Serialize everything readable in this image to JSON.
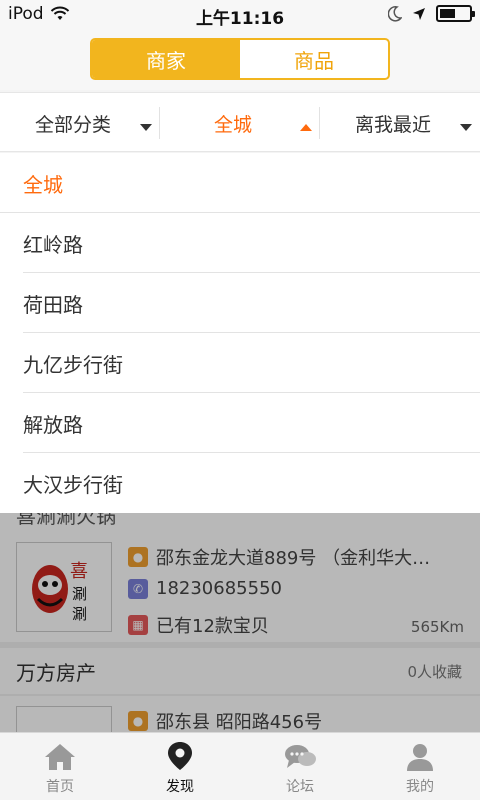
{
  "status_bar": {
    "device": "iPod",
    "time": "上午11:16",
    "battery_level": 0.55
  },
  "header": {
    "segments": [
      {
        "label": "商家",
        "active": true
      },
      {
        "label": "商品",
        "active": false
      }
    ],
    "accent_color": "#f2b51e"
  },
  "filters": [
    {
      "label": "全部分类",
      "active": false
    },
    {
      "label": "全城",
      "active": true
    },
    {
      "label": "离我最近",
      "active": false
    }
  ],
  "dropdown": {
    "items": [
      "全城",
      "红岭路",
      "荷田路",
      "九亿步行街",
      "解放路",
      "大汉步行街"
    ],
    "selected": "全城",
    "highlight_color": "#ff6a0d"
  },
  "list": {
    "shop1": {
      "name_partial": "喜涮涮火锅",
      "address": "邵东金龙大道889号 （金利华大…",
      "phone": "18230685550",
      "products": "已有12款宝贝",
      "distance": "565Km",
      "logo_text": "喜涮涮"
    },
    "shop2": {
      "name": "万方房产",
      "favorites": "0人收藏",
      "address": "邵东县 昭阳路456号"
    }
  },
  "tabbar": {
    "items": [
      {
        "label": "首页",
        "icon": "home-icon",
        "active": false
      },
      {
        "label": "发现",
        "icon": "location-pin-icon",
        "active": true
      },
      {
        "label": "论坛",
        "icon": "chat-bubbles-icon",
        "active": false
      },
      {
        "label": "我的",
        "icon": "user-icon",
        "active": false
      }
    ]
  }
}
